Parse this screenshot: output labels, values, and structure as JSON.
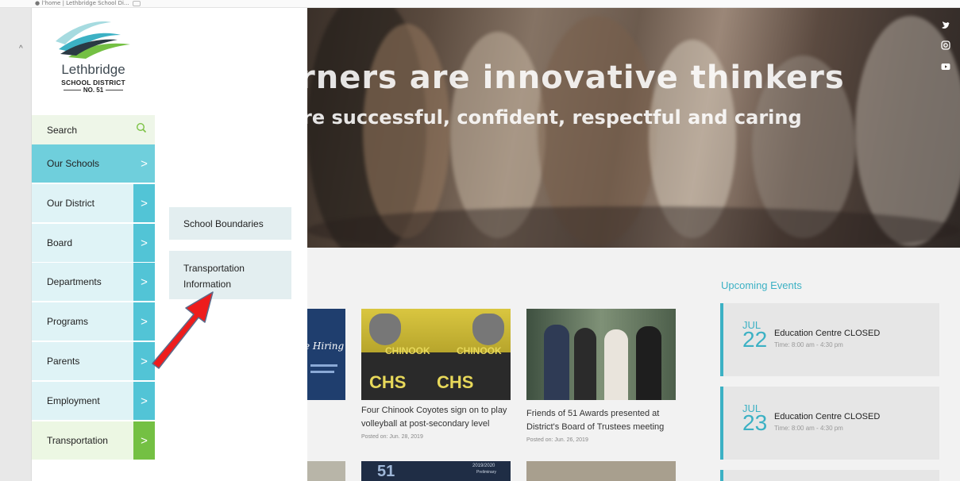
{
  "browser": {
    "url_fragment": "● l’home | Lethbridge School Di..."
  },
  "colors": {
    "accent_teal": "#52c4d6",
    "accent_green": "#74c043",
    "events_teal": "#3cb1c4",
    "annotation_red": "#ee1c1c"
  },
  "logo": {
    "name": "Lethbridge",
    "line1": "SCHOOL DISTRICT",
    "line2": "NO. 51"
  },
  "sidebar": {
    "search_label": "Search",
    "search_icon": "search-icon",
    "items": [
      {
        "label": "Our Schools"
      },
      {
        "label": "Our District"
      },
      {
        "label": "Board"
      },
      {
        "label": "Departments"
      },
      {
        "label": "Programs"
      },
      {
        "label": "Parents"
      },
      {
        "label": "Employment"
      },
      {
        "label": "Transportation"
      }
    ],
    "arrow_glyph": ">"
  },
  "submenu": {
    "items": [
      {
        "label": "School Boundaries"
      },
      {
        "label": "Transportation Information"
      }
    ]
  },
  "hero": {
    "headline": "rners are innovative thinkers",
    "subheadline": "re successful, confident, respectful and caring"
  },
  "news": [
    {
      "title": "Four Chinook Coyotes sign on to play volleyball at post-secondary level",
      "date": "Posted on: Jun. 28, 2019"
    },
    {
      "title": "Friends of 51 Awards presented at District's Board of Trustees meeting",
      "date": "Posted on: Jun. 26, 2019"
    }
  ],
  "card_text": {
    "hiring": "e Hiring",
    "chinook": "CHINOOK",
    "chs": "CHS",
    "fiftyone": "51",
    "year": "2019/2020",
    "preliminary": "Preliminary"
  },
  "events": {
    "title": "Upcoming Events",
    "items": [
      {
        "month": "JUL",
        "day": "22",
        "title": "Education Centre CLOSED",
        "time": "Time: 8:00 am - 4:30 pm"
      },
      {
        "month": "JUL",
        "day": "23",
        "title": "Education Centre CLOSED",
        "time": "Time: 8:00 am - 4:30 pm"
      }
    ]
  }
}
